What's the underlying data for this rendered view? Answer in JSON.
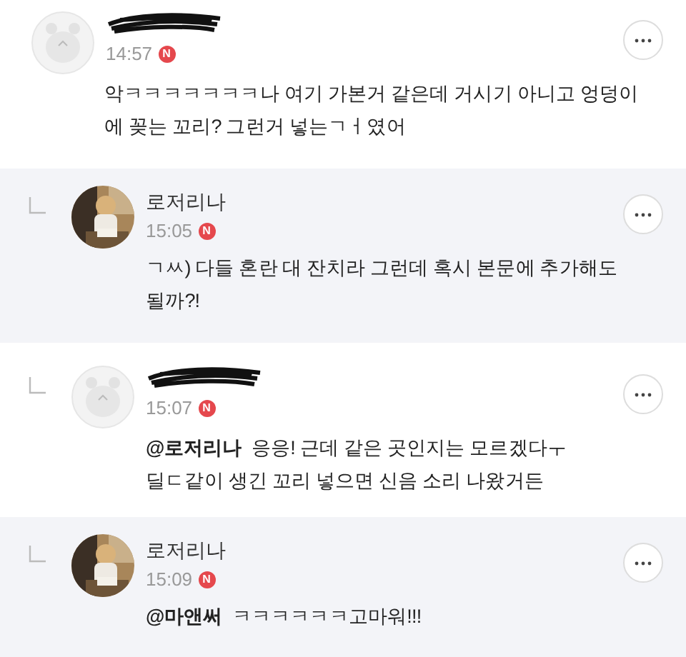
{
  "comments": [
    {
      "reply": false,
      "highlighted": false,
      "avatar_photo": false,
      "name_hidden": true,
      "time": "14:57",
      "new_badge": "N",
      "text": [
        "악ㅋㅋㅋㅋㅋㅋㅋ나 여기 가본거 같은데 거시기 아니고 엉덩이",
        "에 꽂는 꼬리? 그런거 넣는ㄱㅓ였어"
      ]
    },
    {
      "reply": true,
      "highlighted": true,
      "avatar_photo": true,
      "author": "로저리나",
      "time": "15:05",
      "new_badge": "N",
      "text": [
        "ㄱㅆ) 다들 혼란 대 잔치라 그런데 혹시 본문에 추가해도",
        "될까?!"
      ]
    },
    {
      "reply": true,
      "highlighted": false,
      "avatar_photo": false,
      "name_hidden": true,
      "time": "15:07",
      "new_badge": "N",
      "text": [
        "**@로저리나**  응응! 근데 같은 곳인지는 모르겠다ㅜ",
        "딜ㄷ같이 생긴 꼬리 넣으면 신음 소리 나왔거든"
      ]
    },
    {
      "reply": true,
      "highlighted": true,
      "avatar_photo": true,
      "author": "로저리나",
      "time": "15:09",
      "new_badge": "N",
      "text": [
        "**@마앤써**  ㅋㅋㅋㅋㅋㅋ고마워!!!"
      ]
    }
  ]
}
